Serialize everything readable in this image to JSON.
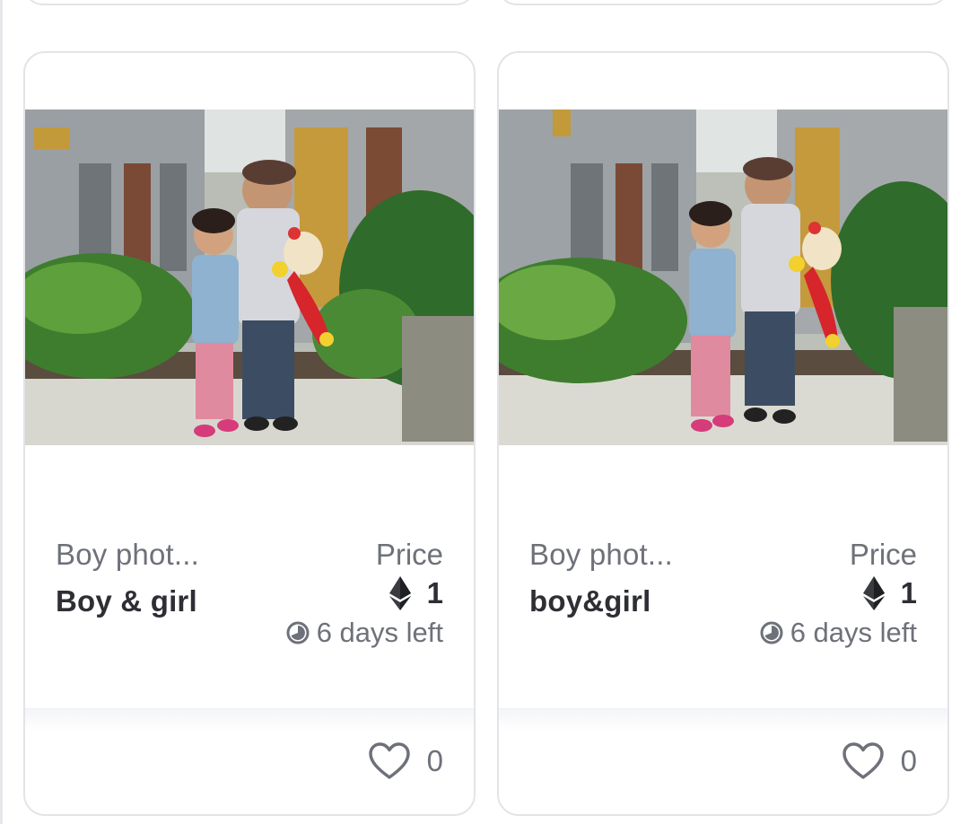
{
  "cards": [
    {
      "collection": "Boy phot...",
      "name": "Boy & girl",
      "price_label": "Price",
      "price": "1",
      "currency_icon": "ethereum-icon",
      "time_left": "6 days left",
      "likes": "0",
      "image_alt": "Boy & girl"
    },
    {
      "collection": "Boy phot...",
      "name": "boy&girl",
      "price_label": "Price",
      "price": "1",
      "currency_icon": "ethereum-icon",
      "time_left": "6 days left",
      "likes": "0",
      "image_alt": "boy&girl"
    }
  ],
  "colors": {
    "card_border": "#e3e4e8",
    "text_primary": "#2e2f34",
    "text_secondary": "#6e7179",
    "footer_tint": "#f3f5f8"
  }
}
